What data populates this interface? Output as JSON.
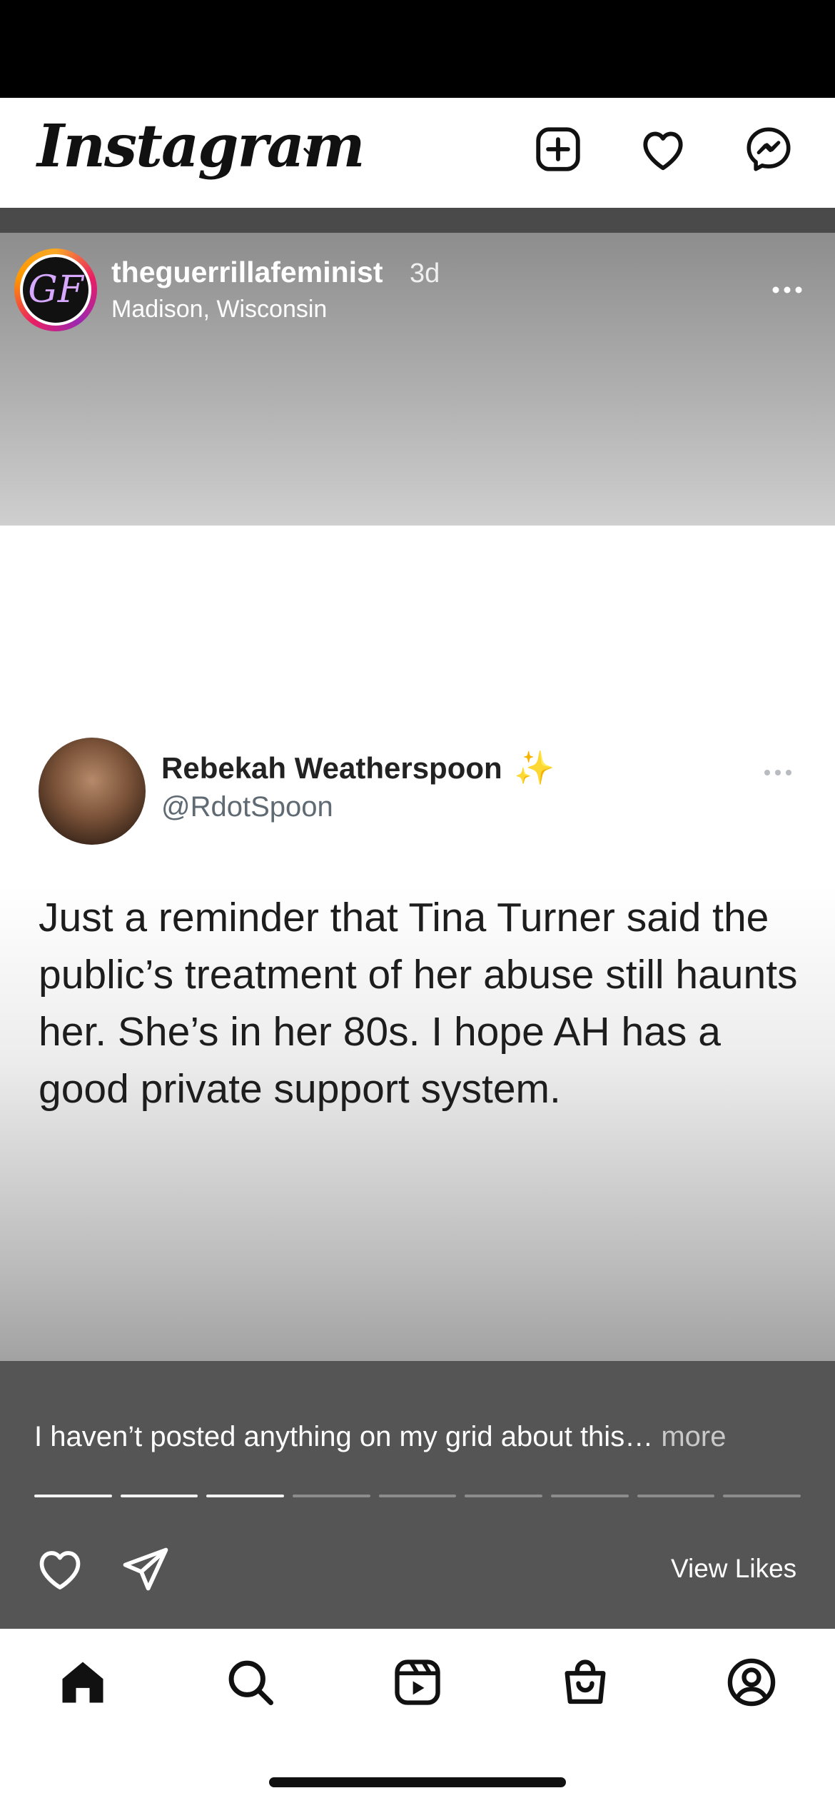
{
  "header": {
    "logo_text": "Instagram",
    "icons": [
      "chevron-down-icon",
      "add-post-icon",
      "heart-icon",
      "messenger-icon"
    ]
  },
  "post": {
    "username": "theguerrillafeminist",
    "age": "3d",
    "location": "Madison, Wisconsin",
    "avatar_initials": "GF",
    "more_icon": "more-horizontal-icon"
  },
  "tweet": {
    "name": "Rebekah Weatherspoon",
    "sparkle": "✨",
    "handle": "@RdotSpoon",
    "text": "Just a reminder that Tina Turner said the public’s treatment of her abuse still haunts her. She’s in her 80s. I hope AH has a good private support system."
  },
  "caption": {
    "text": "I haven’t posted anything on my grid about this…",
    "more_label": "more",
    "slide_count": 9,
    "slides_viewed": 3
  },
  "actions": {
    "view_likes_label": "View Likes",
    "icons": [
      "heart-icon",
      "share-icon"
    ]
  },
  "nav": {
    "items": [
      "home",
      "search",
      "reels",
      "shop",
      "profile"
    ],
    "active": "home"
  },
  "colors": {
    "status_bar": "#000000",
    "caption_panel": "#555555",
    "progress_active": "#f3f3f3",
    "progress_inactive": "#8c8c8c",
    "sparkle": "#f6c945"
  }
}
